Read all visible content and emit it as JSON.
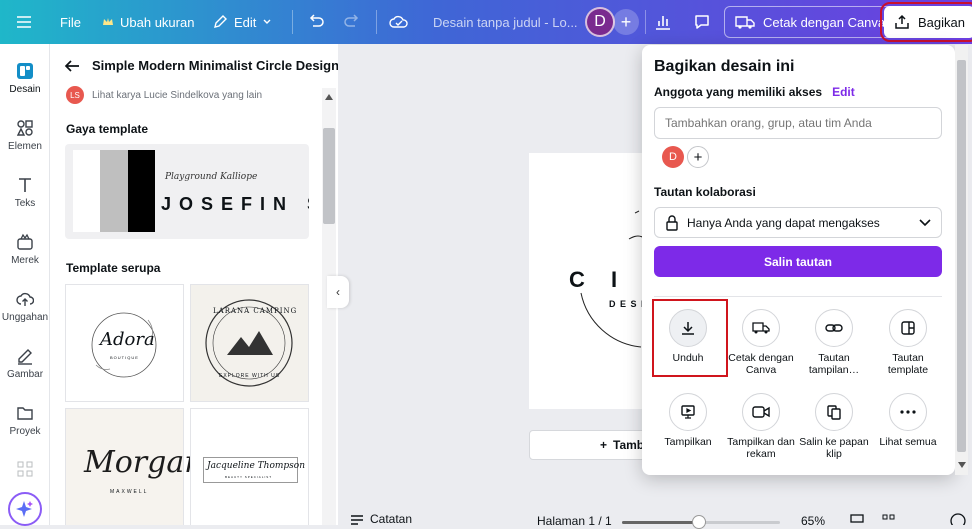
{
  "topbar": {
    "file": "File",
    "resize": "Ubah ukuran",
    "edit": "Edit",
    "doc_title": "Desain tanpa judul - Lo...",
    "avatar_initial": "D",
    "print_button": "Cetak dengan Canva",
    "share_button": "Bagikan"
  },
  "rail": {
    "items": [
      {
        "label": "Desain",
        "icon": "design-icon"
      },
      {
        "label": "Elemen",
        "icon": "elements-icon"
      },
      {
        "label": "Teks",
        "icon": "text-icon"
      },
      {
        "label": "Merek",
        "icon": "brand-icon"
      },
      {
        "label": "Unggahan",
        "icon": "upload-icon"
      },
      {
        "label": "Gambar",
        "icon": "draw-icon"
      },
      {
        "label": "Proyek",
        "icon": "folder-icon"
      }
    ]
  },
  "panel": {
    "title": "Simple Modern Minimalist Circle Design ...",
    "author_initials": "LS",
    "author_text": "Lihat karya Lucie Sindelkova yang lain",
    "style_heading": "Gaya template",
    "style_font_name": "JOSEFIN S",
    "style_script": "Playground Kalliope",
    "similar_heading": "Template serupa",
    "thumbs": {
      "t1_name": "Adora",
      "t1_sub": "BOUTIQUE",
      "t2_name": "LARANA CAMPING",
      "t2_sub": "EXPLORE WITH US",
      "t3_name": "Morgan",
      "t3_sub": "MAXWELL",
      "t4_name": "Jacqueline Thompson",
      "t4_sub": "BEAUTY SPECIALIST"
    }
  },
  "canvas": {
    "big_text": "C I R",
    "small_text": "D E S I G",
    "add_page": "Tamb"
  },
  "bottombar": {
    "notes": "Catatan",
    "page": "Halaman 1 / 1",
    "zoom": "65%",
    "zoom_level": 0.65
  },
  "share": {
    "title": "Bagikan desain ini",
    "members_label": "Anggota yang memiliki akses",
    "edit_link": "Edit",
    "input_placeholder": "Tambahkan orang, grup, atau tim Anda",
    "member_initial": "D",
    "collab_label": "Tautan kolaborasi",
    "access_value": "Hanya Anda yang dapat mengakses",
    "copy_link": "Salin tautan",
    "options": [
      {
        "label": "Unduh",
        "icon": "download-icon"
      },
      {
        "label": "Cetak dengan Canva",
        "icon": "truck-icon"
      },
      {
        "label": "Tautan tampilan…",
        "icon": "link-icon"
      },
      {
        "label": "Tautan template",
        "icon": "template-icon"
      },
      {
        "label": "Tampilkan",
        "icon": "present-icon"
      },
      {
        "label": "Tampilkan dan rekam",
        "icon": "record-icon"
      },
      {
        "label": "Salin ke papan klip",
        "icon": "clipboard-icon"
      },
      {
        "label": "Lihat semua",
        "icon": "more-icon"
      }
    ]
  },
  "colors": {
    "accent": "#7d2ae8",
    "highlight": "#d0151d"
  }
}
